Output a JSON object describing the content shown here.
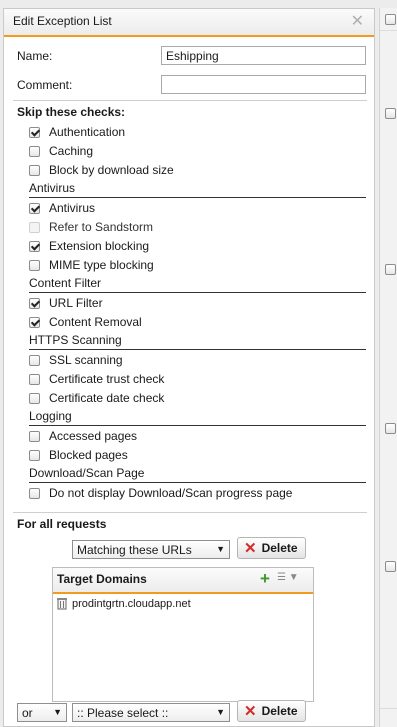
{
  "dialog": {
    "title": "Edit Exception List"
  },
  "form": {
    "name_label": "Name:",
    "name_value": "Eshipping",
    "comment_label": "Comment:",
    "comment_value": ""
  },
  "skip": {
    "heading": "Skip these checks:",
    "general": [
      {
        "label": "Authentication",
        "checked": true,
        "disabled": false
      },
      {
        "label": "Caching",
        "checked": false,
        "disabled": false
      },
      {
        "label": "Block by download size",
        "checked": false,
        "disabled": false
      }
    ],
    "sections": [
      {
        "title": "Antivirus",
        "items": [
          {
            "label": "Antivirus",
            "checked": true,
            "disabled": false
          },
          {
            "label": "Refer to Sandstorm",
            "checked": false,
            "disabled": true
          },
          {
            "label": "Extension blocking",
            "checked": true,
            "disabled": false
          },
          {
            "label": "MIME type blocking",
            "checked": false,
            "disabled": false
          }
        ]
      },
      {
        "title": "Content Filter",
        "items": [
          {
            "label": "URL Filter",
            "checked": true,
            "disabled": false
          },
          {
            "label": "Content Removal",
            "checked": true,
            "disabled": false
          }
        ]
      },
      {
        "title": "HTTPS Scanning",
        "items": [
          {
            "label": "SSL scanning",
            "checked": false,
            "disabled": false
          },
          {
            "label": "Certificate trust check",
            "checked": false,
            "disabled": false
          },
          {
            "label": "Certificate date check",
            "checked": false,
            "disabled": false
          }
        ]
      },
      {
        "title": "Logging",
        "items": [
          {
            "label": "Accessed pages",
            "checked": false,
            "disabled": false
          },
          {
            "label": "Blocked pages",
            "checked": false,
            "disabled": false
          }
        ]
      },
      {
        "title": "Download/Scan Page",
        "items": [
          {
            "label": "Do not display Download/Scan progress page",
            "checked": false,
            "disabled": false
          }
        ]
      }
    ]
  },
  "requests": {
    "heading": "For all requests",
    "condition_select": "Matching these URLs",
    "delete_label": "Delete",
    "domains_title": "Target Domains",
    "domains": [
      "prodintgrtn.cloudapp.net"
    ],
    "or_select": "or",
    "second_select": ":: Please select ::",
    "delete2_label": "Delete"
  },
  "colors": {
    "accent": "#f29c1f",
    "delete": "#d42a2a",
    "add": "#3a9a2a"
  },
  "icons": {
    "close": "close-icon",
    "delete": "delete-icon",
    "add": "add-icon",
    "list": "list-menu-icon",
    "trash": "trash-icon"
  }
}
